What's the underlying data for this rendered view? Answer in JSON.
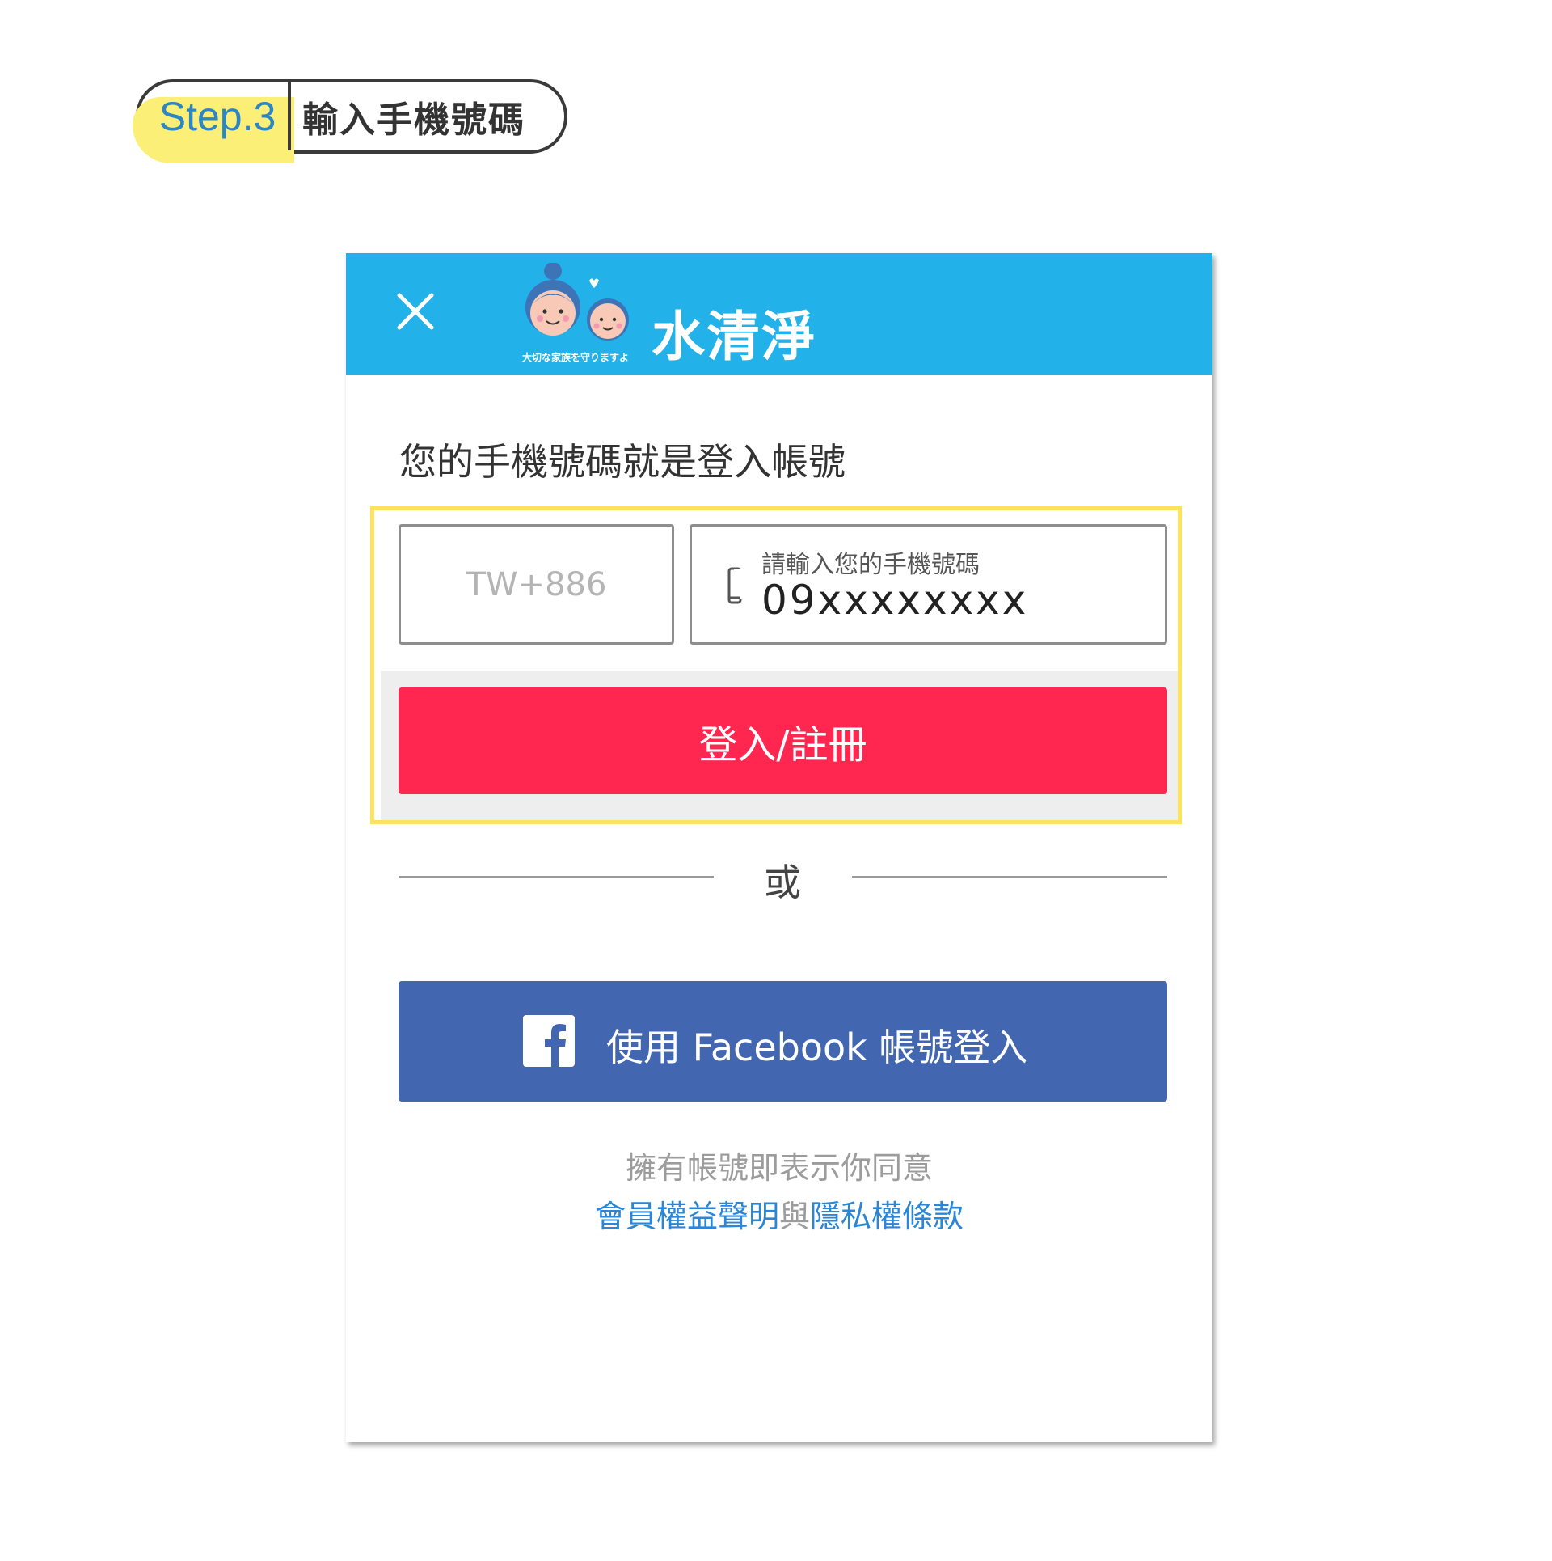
{
  "step": {
    "label": "Step.3",
    "title": "輸入手機號碼"
  },
  "header": {
    "brand_name": "水清淨",
    "brand_tagline": "大切な家族を守りますよ",
    "close_icon": "close-icon",
    "background_color": "#22b1e9"
  },
  "prompt": "您的手機號碼就是登入帳號",
  "country_code": {
    "placeholder": "TW+886"
  },
  "phone": {
    "icon": "phone-icon",
    "label": "請輸入您的手機號碼",
    "value": "09xxxxxxxx"
  },
  "login_button": {
    "label": "登入/註冊",
    "color": "#ff2750"
  },
  "divider": {
    "label": "或"
  },
  "facebook_button": {
    "icon": "facebook-icon",
    "label": "使用 Facebook 帳號登入",
    "color": "#4266b0"
  },
  "terms": {
    "line1": "擁有帳號即表示你同意",
    "member_rights_link": "會員權益聲明",
    "connector": "與",
    "privacy_link": "隱私權條款"
  },
  "colors": {
    "highlight_border": "#fce25e",
    "link": "#2a86d8"
  }
}
